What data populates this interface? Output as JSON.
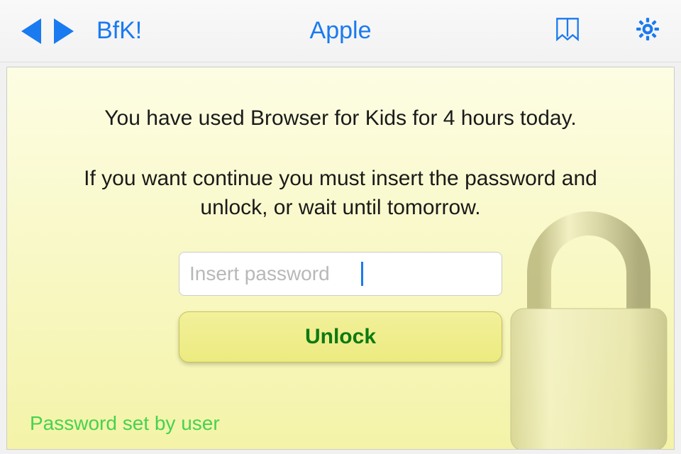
{
  "toolbar": {
    "brand": "BfK!",
    "title": "Apple"
  },
  "lock_screen": {
    "message_line1": "You have used Browser for Kids for 4 hours today.",
    "message_line2": "If you want continue you must insert the password and unlock, or wait until tomorrow.",
    "password_placeholder": "Insert password",
    "unlock_label": "Unlock",
    "footer": "Password set by user"
  },
  "colors": {
    "accent": "#1a7af0",
    "unlock_text": "#0d7a10",
    "footer_text": "#47d24e"
  }
}
